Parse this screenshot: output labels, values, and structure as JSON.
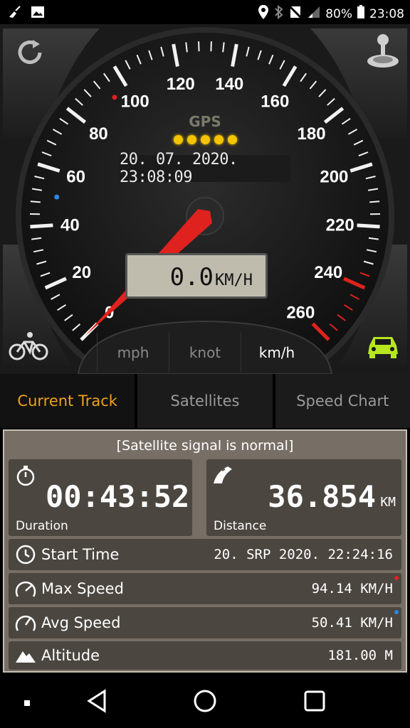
{
  "status_bar": {
    "battery": "80%",
    "time": "23:08",
    "icons": [
      "broom-icon",
      "image-icon",
      "location-pin-icon",
      "bluetooth-icon",
      "mute-icon",
      "signal-icon",
      "battery-icon"
    ]
  },
  "gauge": {
    "ticks": [
      "0",
      "20",
      "40",
      "60",
      "80",
      "100",
      "120",
      "140",
      "160",
      "180",
      "200",
      "220",
      "240",
      "260"
    ],
    "gps_label": "GPS",
    "datetime": "20. 07. 2020. 23:08:09",
    "speed_value": "0.0",
    "speed_unit": "KM/H",
    "current_speed": 0,
    "units": [
      "mph",
      "knot",
      "km/h"
    ],
    "active_unit": "km/h",
    "colors": {
      "needle": "#e0221e",
      "redline": "#e0221e",
      "car": "#b6e61e",
      "gps_dots": "#f5c400"
    }
  },
  "tabs": [
    "Current Track",
    "Satellites",
    "Speed Chart"
  ],
  "track": {
    "status": "[Satellite signal is normal]",
    "duration": "00:43:52",
    "duration_label": "Duration",
    "distance": "36.854",
    "distance_unit": "KM",
    "distance_label": "Distance",
    "start_time_label": "Start Time",
    "start_time": "20. SRP 2020. 22:24:16",
    "max_speed_label": "Max Speed",
    "max_speed": "94.14 KM/H",
    "avg_speed_label": "Avg Speed",
    "avg_speed": "50.41 KM/H",
    "altitude_label": "Altitude",
    "altitude": "181.00 M"
  }
}
